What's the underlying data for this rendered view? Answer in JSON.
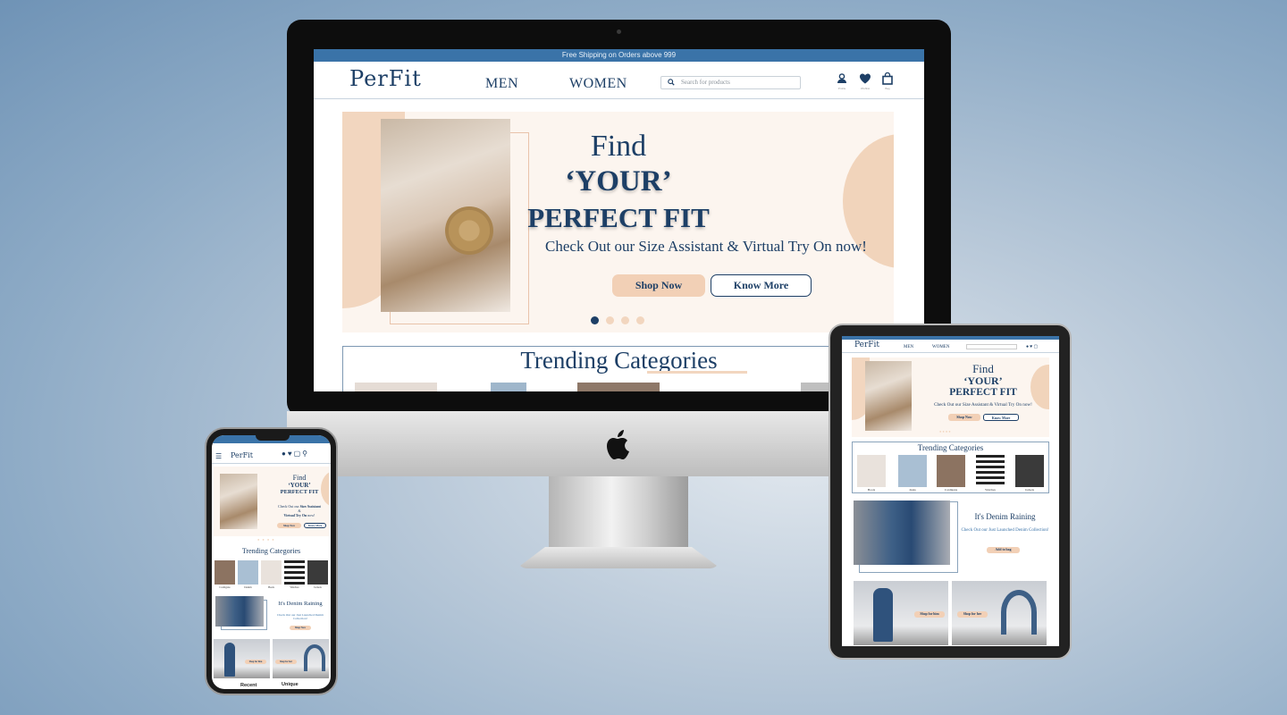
{
  "site": {
    "shipping_banner": "Free Shipping on Orders above 999",
    "logo": "PerFit",
    "nav": [
      "MEN",
      "WOMEN"
    ],
    "search_placeholder": "Search for products",
    "icons": [
      "profile-icon",
      "wishlist-icon",
      "bag-icon"
    ],
    "icon_labels": [
      "Profile",
      "Wishlist",
      "Bag"
    ]
  },
  "hero": {
    "line1": "Find",
    "line2": "‘YOUR’",
    "line3": "PERFECT FIT",
    "subtitle": "Check Out our Size Assistant & Virtual Try On now!",
    "shop_now": "Shop Now",
    "know_more": "Know More",
    "slide_count": 4,
    "active_slide": 1
  },
  "trending": {
    "title": "Trending Categories",
    "tablet_categories": [
      "Boots",
      "Jeans",
      "Cardigans",
      "Watches",
      "Jackets"
    ],
    "phone_categories": [
      "Cardigans",
      "Denim",
      "Heels",
      "Watches",
      "Jackets"
    ]
  },
  "denim": {
    "title": "It's Denim Raining",
    "subtitle": "Check Out our Just Launched Denim Collection!",
    "tablet_button": "Add to bag",
    "phone_button": "Shop Now",
    "shop_him": "Shop for him",
    "shop_her": "Shop for her"
  },
  "phone": {
    "hero_sub1": "Check Out our",
    "hero_sub_bold1": "Size Assistant",
    "hero_amp": "&",
    "hero_sub_bold2": "Virtual Try On",
    "hero_sub_tail": "now!",
    "bottom_left": "Recent",
    "bottom_right": "Unique"
  }
}
